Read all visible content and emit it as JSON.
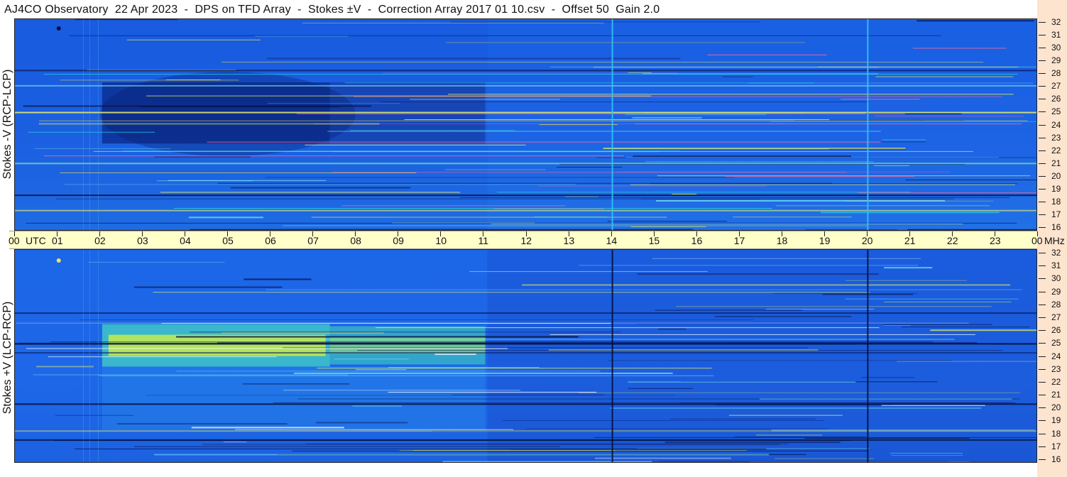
{
  "header": {
    "title": "AJ4CO Observatory  22 Apr 2023  -  DPS on TFD Array  -  Stokes ±V  -  Correction Array 2017 01 10.csv  -  Offset 50  Gain 2.0"
  },
  "panels": [
    {
      "ylabel": "Stokes -V (RCP-LCP)"
    },
    {
      "ylabel": "Stokes +V (LCP-RCP)"
    }
  ],
  "time_axis": {
    "labels": [
      "00",
      "UTC",
      "01",
      "02",
      "03",
      "04",
      "05",
      "06",
      "07",
      "08",
      "09",
      "10",
      "11",
      "12",
      "13",
      "14",
      "15",
      "16",
      "17",
      "18",
      "19",
      "20",
      "21",
      "22",
      "23",
      "00",
      "MHz"
    ]
  },
  "freq_axis": {
    "labels": [
      "32",
      "31",
      "30",
      "29",
      "28",
      "27",
      "26",
      "25",
      "24",
      "23",
      "22",
      "21",
      "20",
      "19",
      "18",
      "17",
      "16"
    ]
  },
  "colors": {
    "background_blue": "#1a66e6",
    "freq_strip": "#fde4cf",
    "time_strip": "#ffffc9"
  },
  "chart_data": [
    {
      "type": "heatmap",
      "title": "Stokes -V (RCP-LCP)",
      "xlabel": "UTC",
      "ylabel": "MHz",
      "x_range": [
        0,
        24
      ],
      "y_range": [
        16,
        32
      ],
      "x_ticks": [
        "00",
        "01",
        "02",
        "03",
        "04",
        "05",
        "06",
        "07",
        "08",
        "09",
        "10",
        "11",
        "12",
        "13",
        "14",
        "15",
        "16",
        "17",
        "18",
        "19",
        "20",
        "21",
        "22",
        "23",
        "00"
      ],
      "y_ticks": [
        32,
        31,
        30,
        29,
        28,
        27,
        26,
        25,
        24,
        23,
        22,
        21,
        20,
        19,
        18,
        17,
        16
      ]
    },
    {
      "type": "heatmap",
      "title": "Stokes +V (LCP-RCP)",
      "xlabel": "UTC",
      "ylabel": "MHz",
      "x_range": [
        0,
        24
      ],
      "y_range": [
        16,
        32
      ],
      "x_ticks": [
        "00",
        "01",
        "02",
        "03",
        "04",
        "05",
        "06",
        "07",
        "08",
        "09",
        "10",
        "11",
        "12",
        "13",
        "14",
        "15",
        "16",
        "17",
        "18",
        "19",
        "20",
        "21",
        "22",
        "23",
        "00"
      ],
      "y_ticks": [
        32,
        31,
        30,
        29,
        28,
        27,
        26,
        25,
        24,
        23,
        22,
        21,
        20,
        19,
        18,
        17,
        16
      ]
    }
  ]
}
